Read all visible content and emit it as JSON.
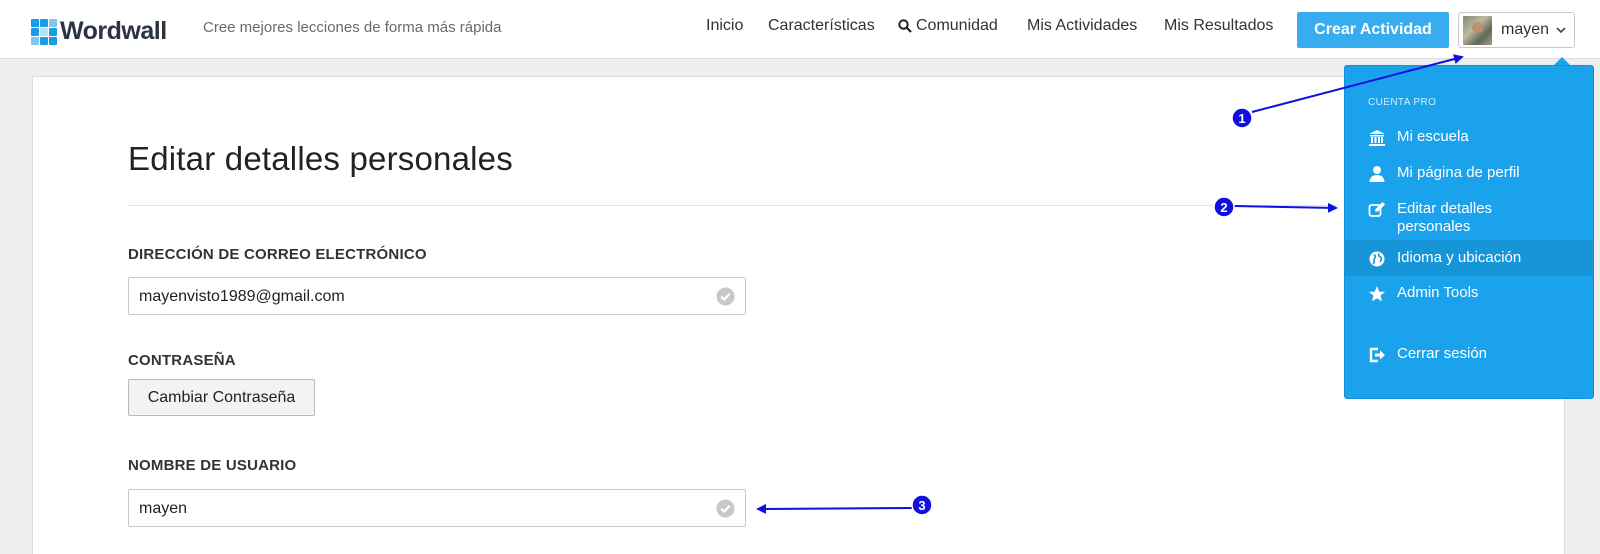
{
  "header": {
    "brand": "Wordwall",
    "tagline": "Cree mejores lecciones de forma más rápida",
    "nav": {
      "home": "Inicio",
      "features": "Características",
      "community": "Comunidad",
      "my_activities": "Mis Actividades",
      "my_results": "Mis Resultados"
    },
    "create_button": "Crear Actividad",
    "user_name": "mayen"
  },
  "page": {
    "title": "Editar detalles personales",
    "email_label": "DIRECCIÓN DE CORREO ELECTRÓNICO",
    "email_value": "mayenvisto1989@gmail.com",
    "password_label": "CONTRASEÑA",
    "password_button": "Cambiar Contraseña",
    "username_label": "NOMBRE DE USUARIO",
    "username_value": "mayen"
  },
  "dropdown": {
    "heading": "CUENTA PRO",
    "items": [
      {
        "label": "Mi escuela",
        "icon": "bank-icon"
      },
      {
        "label": "Mi página de perfil",
        "icon": "user-icon"
      },
      {
        "label": "Editar detalles personales",
        "icon": "edit-icon"
      },
      {
        "label": "Idioma y ubicación",
        "icon": "globe-icon"
      },
      {
        "label": "Admin Tools",
        "icon": "star-icon"
      },
      {
        "label": "Cerrar sesión",
        "icon": "sign-out-icon"
      }
    ]
  },
  "annotations": {
    "markers": [
      "1",
      "2",
      "3"
    ],
    "color": "#1010e0"
  },
  "colors": {
    "accent": "#37adf0",
    "dropdown_bg": "#1aa3ec",
    "logo_blue": "#1a9be6"
  }
}
